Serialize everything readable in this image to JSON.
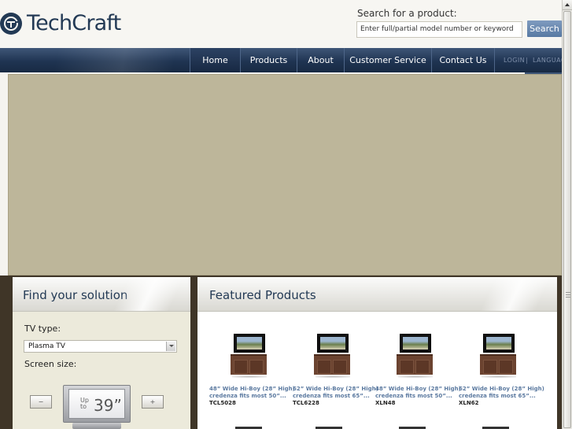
{
  "header": {
    "logo_text": "TechCraft",
    "search_label": "Search for a product:",
    "search_placeholder": "Enter full/partial model number or keyword",
    "search_button": "Search"
  },
  "nav": {
    "items": [
      {
        "label": "Home",
        "active": true
      },
      {
        "label": "Products"
      },
      {
        "label": "About"
      },
      {
        "label": "Customer Service"
      },
      {
        "label": "Contact Us"
      }
    ],
    "login": "LOGIN",
    "separator": "|",
    "language": "LANGUAG"
  },
  "colors": {
    "brand": "#233a55",
    "hero_background": "#bdb69a",
    "product_link": "#5c7aa0"
  },
  "find_solution": {
    "title": "Find your solution",
    "tv_type_label": "TV type:",
    "tv_type_value": "Plasma TV",
    "screen_size_label": "Screen size:",
    "decrease_label": "−",
    "increase_label": "+",
    "size_prefix_top": "Up",
    "size_prefix_bottom": "to",
    "size_value": "39”"
  },
  "featured": {
    "title": "Featured Products",
    "products": [
      {
        "name_line1": "48” Wide Hi-Boy (28” High)",
        "name_line2": "credenza fits most 50”...",
        "sku": "TCL5028",
        "icon": "tv-credenza-image"
      },
      {
        "name_line1": "62” Wide Hi-Boy (28” High)",
        "name_line2": "credenza fits most 65”...",
        "sku": "TCL6228",
        "icon": "tv-credenza-image"
      },
      {
        "name_line1": "48” Wide Hi-Boy (28” High)",
        "name_line2": "credenza fits most 50”...",
        "sku": "XLN48",
        "icon": "tv-credenza-image"
      },
      {
        "name_line1": "62” Wide Hi-Boy (28” High)",
        "name_line2": "credenza fits most 65”...",
        "sku": "XLN62",
        "icon": "tv-credenza-image"
      }
    ]
  }
}
